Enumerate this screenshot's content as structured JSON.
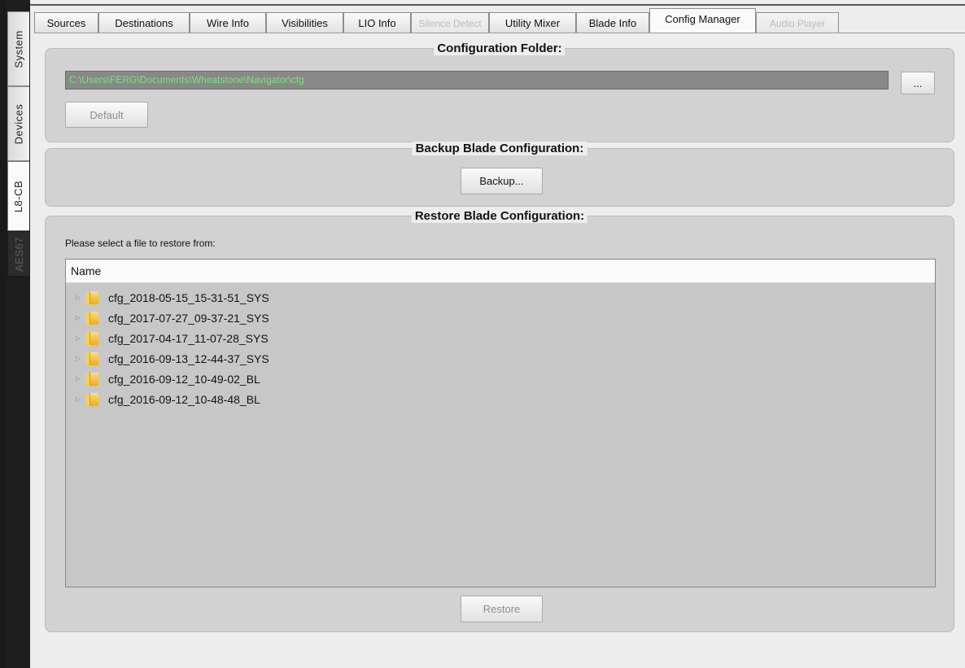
{
  "vertical_tabs": [
    {
      "label": "System",
      "state": "normal"
    },
    {
      "label": "Devices",
      "state": "normal"
    },
    {
      "label": "L8-CB",
      "state": "active"
    },
    {
      "label": "AES67",
      "state": "disabled"
    }
  ],
  "top_tabs": [
    {
      "label": "Sources",
      "state": "normal"
    },
    {
      "label": "Destinations",
      "state": "normal"
    },
    {
      "label": "Wire Info",
      "state": "normal"
    },
    {
      "label": "Visibilities",
      "state": "normal"
    },
    {
      "label": "LIO Info",
      "state": "normal"
    },
    {
      "label": "Silence Detect",
      "state": "disabled"
    },
    {
      "label": "Utility Mixer",
      "state": "normal"
    },
    {
      "label": "Blade Info",
      "state": "normal"
    },
    {
      "label": "Config Manager",
      "state": "active"
    },
    {
      "label": "Audio Player",
      "state": "disabled"
    }
  ],
  "config_folder": {
    "title": "Configuration Folder:",
    "path": "C:\\Users\\FERG\\Documents\\Wheatstone\\Navigator\\cfg",
    "browse_label": "...",
    "default_label": "Default"
  },
  "backup": {
    "title": "Backup Blade Configuration:",
    "button_label": "Backup..."
  },
  "restore": {
    "title": "Restore Blade Configuration:",
    "hint": "Please select a file to restore from:",
    "column_name": "Name",
    "files": [
      "cfg_2018-05-15_15-31-51_SYS",
      "cfg_2017-07-27_09-37-21_SYS",
      "cfg_2017-04-17_11-07-28_SYS",
      "cfg_2016-09-13_12-44-37_SYS",
      "cfg_2016-09-12_10-49-02_BL",
      "cfg_2016-09-12_10-48-48_BL"
    ],
    "button_label": "Restore"
  },
  "colors": {
    "path_text": "#7ee37e",
    "path_background": "#888888",
    "group_background": "#d2d2d2",
    "sidebar_background": "#1e1e1e",
    "folder_icon": "#e8ad20"
  }
}
